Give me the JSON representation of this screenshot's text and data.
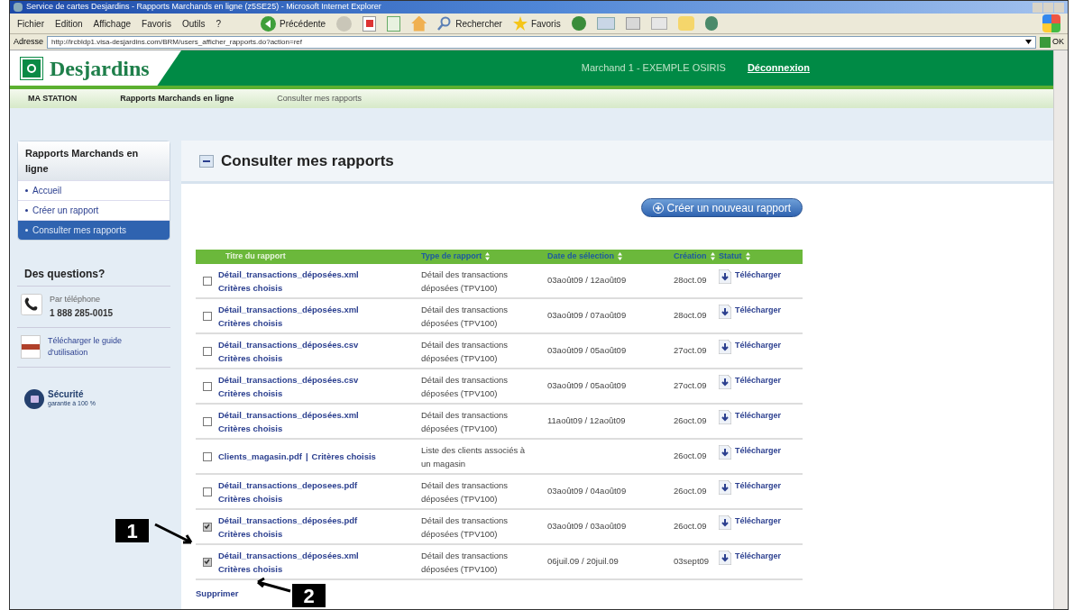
{
  "window": {
    "title": "Service de cartes Desjardins - Rapports Marchands en ligne (z5SE25) - Microsoft Internet Explorer"
  },
  "menu": [
    "Fichier",
    "Edition",
    "Affichage",
    "Favoris",
    "Outils",
    "?"
  ],
  "toolbar": {
    "back": "Précédente",
    "search": "Rechercher",
    "favorites": "Favoris"
  },
  "address": {
    "label": "Adresse",
    "url": "http://lrcbldp1.visa-desjardins.com/BRM/users_afficher_rapports.do?action=ref",
    "go": "OK"
  },
  "header": {
    "brand": "Desjardins",
    "merchant": "Marchand 1 - EXEMPLE OSIRIS",
    "logout": "Déconnexion"
  },
  "breadcrumb": [
    {
      "label": "MA STATION",
      "bold": true
    },
    {
      "label": "Rapports Marchands en ligne",
      "bold": true
    },
    {
      "label": "Consulter mes rapports",
      "bold": false
    }
  ],
  "sidebar": {
    "title": "Rapports Marchands en ligne",
    "items": [
      {
        "label": "Accueil",
        "selected": false
      },
      {
        "label": "Créer un rapport",
        "selected": false
      },
      {
        "label": "Consulter mes rapports",
        "selected": true
      }
    ],
    "questions": "Des questions?",
    "phone_label": "Par téléphone",
    "phone": "1 888 285-0015",
    "guide": "Télécharger le guide d'utilisation",
    "security": "Sécurité",
    "security_note": "garantie à 100 %"
  },
  "page_title": "Consulter mes rapports",
  "create_button": "Créer un nouveau rapport",
  "table": {
    "columns": [
      "Titre du rapport",
      "Type de rapport",
      "Date de sélection",
      "Création",
      "Statut"
    ],
    "rows": [
      {
        "checked": false,
        "file": "Détail_transactions_déposées.xml",
        "criteria": "Critères choisis",
        "type": "Détail des transactions déposées (TPV100)",
        "dates": "03août09 / 12août09",
        "created": "28oct.09",
        "status": "Télécharger"
      },
      {
        "checked": false,
        "file": "Détail_transactions_déposées.xml",
        "criteria": "Critères choisis",
        "type": "Détail des transactions déposées (TPV100)",
        "dates": "03août09 / 07août09",
        "created": "28oct.09",
        "status": "Télécharger"
      },
      {
        "checked": false,
        "file": "Détail_transactions_déposées.csv",
        "criteria": "Critères choisis",
        "type": "Détail des transactions déposées (TPV100)",
        "dates": "03août09 / 05août09",
        "created": "27oct.09",
        "status": "Télécharger"
      },
      {
        "checked": false,
        "file": "Détail_transactions_déposées.csv",
        "criteria": "Critères choisis",
        "type": "Détail des transactions déposées (TPV100)",
        "dates": "03août09 / 05août09",
        "created": "27oct.09",
        "status": "Télécharger"
      },
      {
        "checked": false,
        "file": "Détail_transactions_déposées.xml",
        "criteria": "Critères choisis",
        "type": "Détail des transactions déposées (TPV100)",
        "dates": "11août09 / 12août09",
        "created": "26oct.09",
        "status": "Télécharger"
      },
      {
        "checked": false,
        "kind": "inline",
        "file": "Clients_magasin.pdf",
        "sep": "|",
        "inline_criteria": "Critères choisis",
        "type": "Liste des clients associés à un magasin",
        "created": "26oct.09",
        "status": "Télécharger"
      },
      {
        "checked": false,
        "file": "Détail_transactions_deposees.pdf",
        "criteria": "Critères choisis",
        "type": "Détail des transactions déposées (TPV100)",
        "dates": "03août09 / 04août09",
        "created": "26oct.09",
        "status": "Télécharger"
      },
      {
        "checked": true,
        "file": "Détail_transactions_déposées.pdf",
        "criteria": "Critères choisis",
        "type": "Détail des transactions déposées (TPV100)",
        "dates": "03août09 / 03août09",
        "created": "26oct.09",
        "status": "Télécharger"
      },
      {
        "checked": true,
        "file": "Détail_transactions_déposées.xml",
        "criteria": "Critères choisis",
        "type": "Détail des transactions déposées (TPV100)",
        "dates": "06juil.09 / 20juil.09",
        "created": "03sept09",
        "status": "Télécharger"
      }
    ]
  },
  "delete_link": "Supprimer",
  "callouts": [
    {
      "label": "1"
    },
    {
      "label": "2"
    }
  ]
}
